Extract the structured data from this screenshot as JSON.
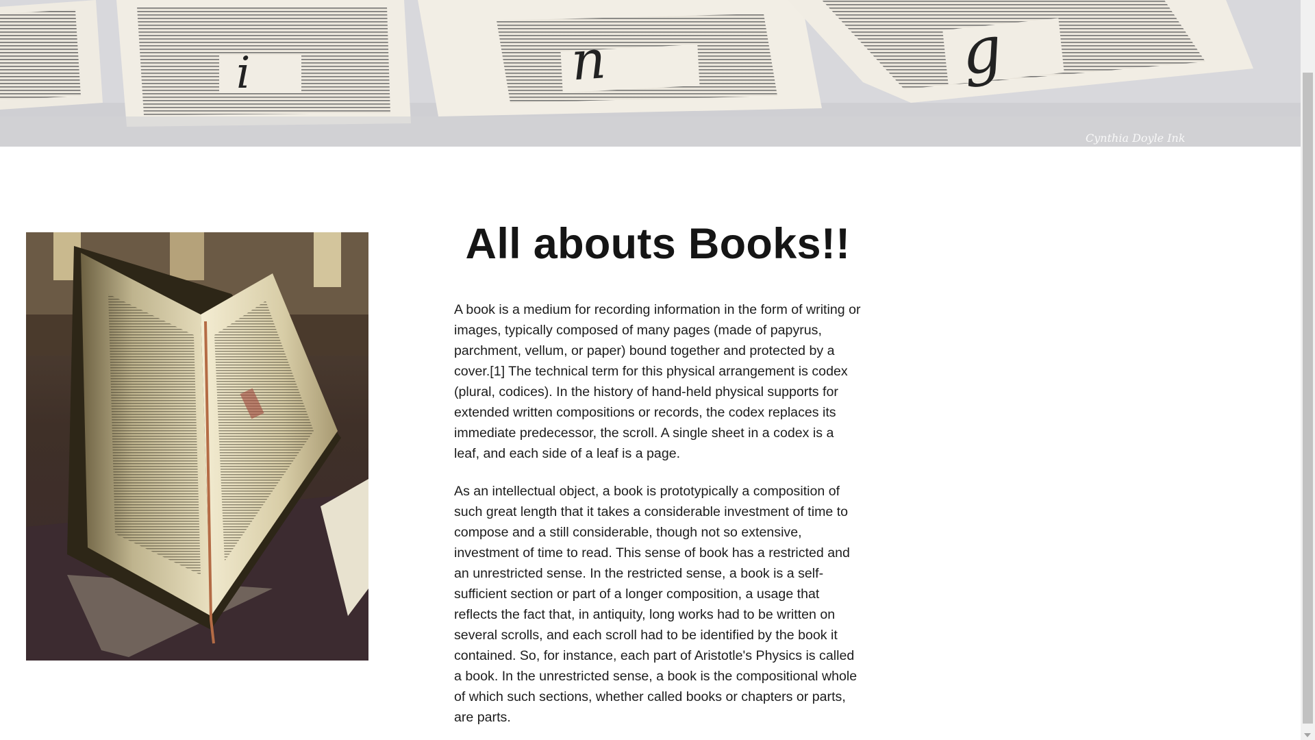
{
  "hero": {
    "banner_letters": [
      "i",
      "n",
      "g"
    ],
    "watermark": "Cynthia Doyle Ink"
  },
  "article": {
    "title": "All abouts Books!!",
    "paragraphs": [
      "A book is a medium for recording information in the form of writing or images, typically composed of many pages (made of papyrus, parchment, vellum, or paper) bound together and protected by a cover.[1] The technical term for this physical arrangement is codex (plural, codices). In the history of hand-held physical supports for extended written compositions or records, the codex replaces its immediate predecessor, the scroll. A single sheet in a codex is a leaf, and each side of a leaf is a page.",
      "As an intellectual object, a book is prototypically a composition of such great length that it takes a considerable investment of time to compose and a still considerable, though not so extensive, investment of time to read. This sense of book has a restricted and an unrestricted sense. In the restricted sense, a book is a self-sufficient section or part of a longer composition, a usage that reflects the fact that, in antiquity, long works had to be written on several scrolls, and each scroll had to be identified by the book it contained. So, for instance, each part of Aristotle's Physics is called a book. In the unrestricted sense, a book is the compositional whole of which such sections, whether called books or chapters or parts, are parts."
    ]
  },
  "images": {
    "hero_icon": "book-pages-banner-image",
    "side_icon": "open-book-photo"
  },
  "colors": {
    "background": "#ffffff",
    "text": "#1c1c1c",
    "scrollbar_track": "#f1f1f1",
    "scrollbar_thumb": "#c1c1c1"
  }
}
